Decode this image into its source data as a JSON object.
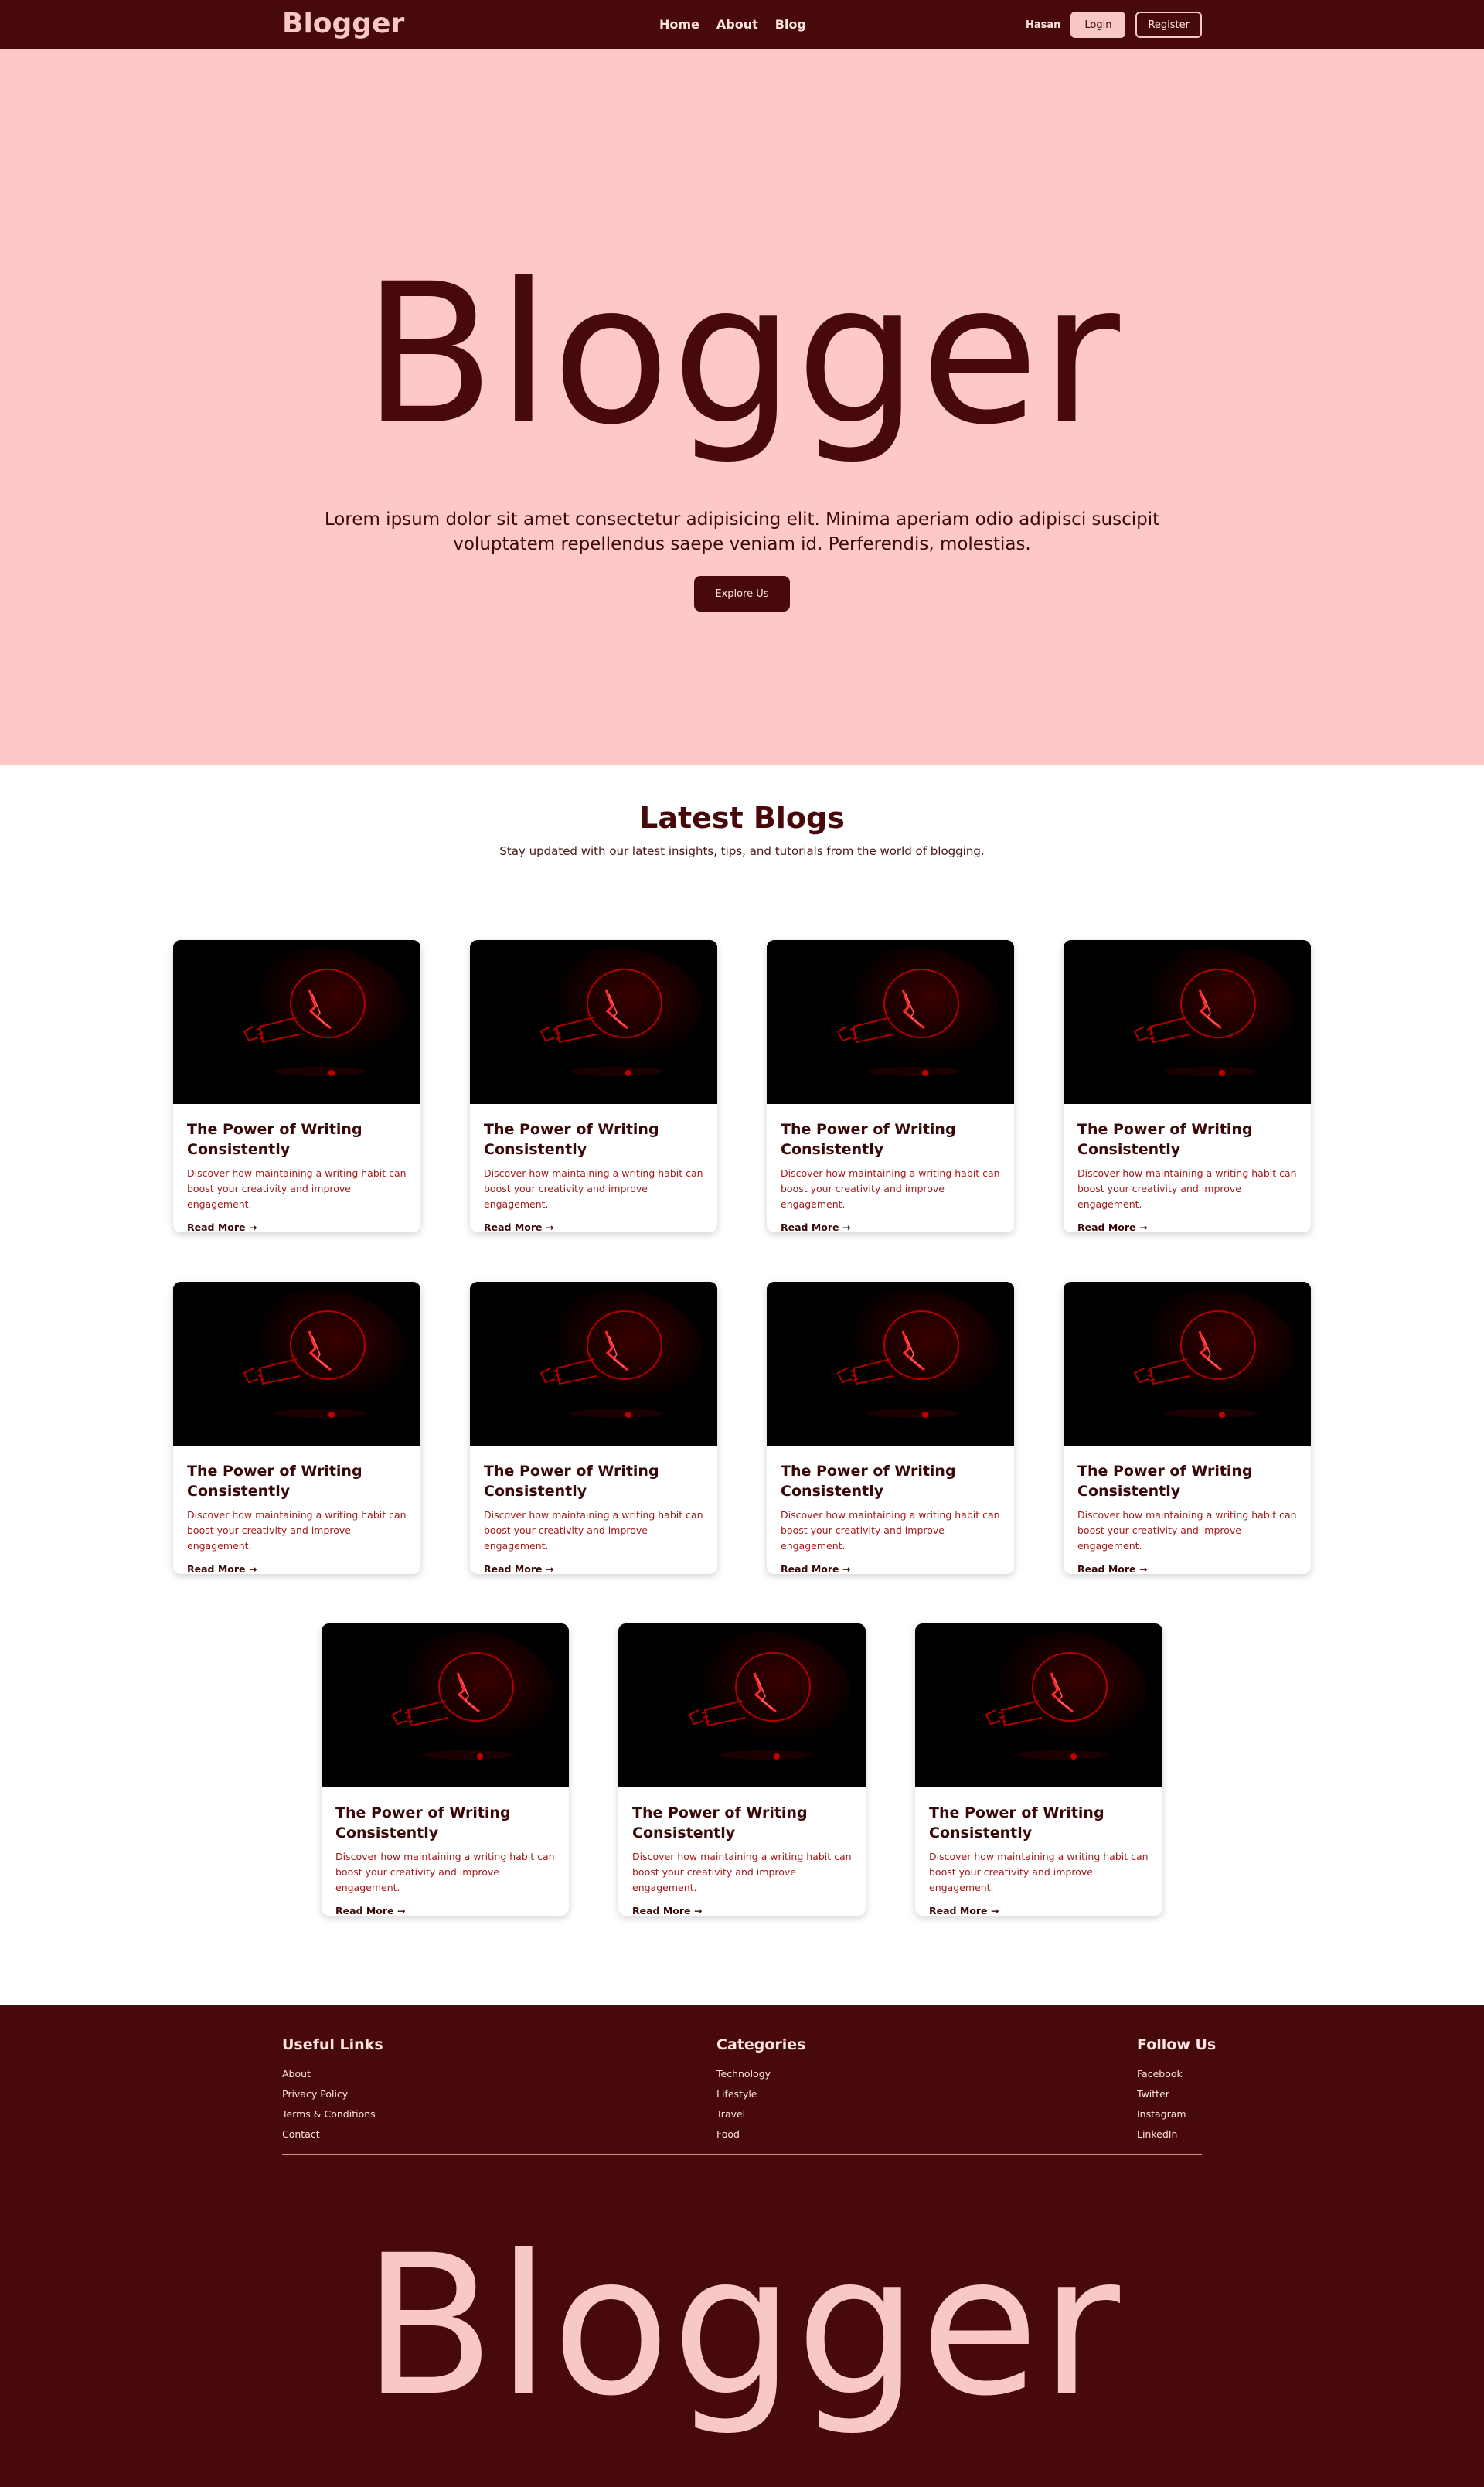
{
  "nav": {
    "brand": "Blogger",
    "links": [
      "Home",
      "About",
      "Blog"
    ],
    "username": "Hasan",
    "login_label": "Login",
    "register_label": "Register"
  },
  "hero": {
    "title": "Blogger",
    "text": "Lorem ipsum dolor sit amet consectetur adipisicing elit. Minima aperiam odio adipisci suscipit voluptatem repellendus saepe veniam id. Perferendis, molestias.",
    "button_label": "Explore Us"
  },
  "blogs": {
    "title": "Latest Blogs",
    "subtitle": "Stay updated with our latest insights, tips, and tutorials from the world of blogging.",
    "cards": [
      {
        "title": "The Power of Writing Consistently",
        "text": "Discover how maintaining a writing habit can boost your creativity and improve engagement.",
        "link": "Read More →"
      },
      {
        "title": "The Power of Writing Consistently",
        "text": "Discover how maintaining a writing habit can boost your creativity and improve engagement.",
        "link": "Read More →"
      },
      {
        "title": "The Power of Writing Consistently",
        "text": "Discover how maintaining a writing habit can boost your creativity and improve engagement.",
        "link": "Read More →"
      },
      {
        "title": "The Power of Writing Consistently",
        "text": "Discover how maintaining a writing habit can boost your creativity and improve engagement.",
        "link": "Read More →"
      },
      {
        "title": "The Power of Writing Consistently",
        "text": "Discover how maintaining a writing habit can boost your creativity and improve engagement.",
        "link": "Read More →"
      },
      {
        "title": "The Power of Writing Consistently",
        "text": "Discover how maintaining a writing habit can boost your creativity and improve engagement.",
        "link": "Read More →"
      },
      {
        "title": "The Power of Writing Consistently",
        "text": "Discover how maintaining a writing habit can boost your creativity and improve engagement.",
        "link": "Read More →"
      },
      {
        "title": "The Power of Writing Consistently",
        "text": "Discover how maintaining a writing habit can boost your creativity and improve engagement.",
        "link": "Read More →"
      },
      {
        "title": "The Power of Writing Consistently",
        "text": "Discover how maintaining a writing habit can boost your creativity and improve engagement.",
        "link": "Read More →"
      },
      {
        "title": "The Power of Writing Consistently",
        "text": "Discover how maintaining a writing habit can boost your creativity and improve engagement.",
        "link": "Read More →"
      },
      {
        "title": "The Power of Writing Consistently",
        "text": "Discover how maintaining a writing habit can boost your creativity and improve engagement.",
        "link": "Read More →"
      }
    ]
  },
  "footer": {
    "useful_links": {
      "title": "Useful Links",
      "items": [
        "About",
        "Privacy Policy",
        "Terms & Conditions",
        "Contact"
      ]
    },
    "categories": {
      "title": "Categories",
      "items": [
        "Technology",
        "Lifestyle",
        "Travel",
        "Food"
      ]
    },
    "follow": {
      "title": "Follow Us",
      "items": [
        "Facebook",
        "Twitter",
        "Instagram",
        "LinkedIn"
      ]
    },
    "big_text": "Blogger"
  },
  "colors": {
    "primary": "#470909",
    "hero_bg": "#fec8c7",
    "accent_pink": "#f7c8c6",
    "card_text": "#a31a1a"
  },
  "icons": {
    "card_image": "red-lightbulb-image"
  }
}
